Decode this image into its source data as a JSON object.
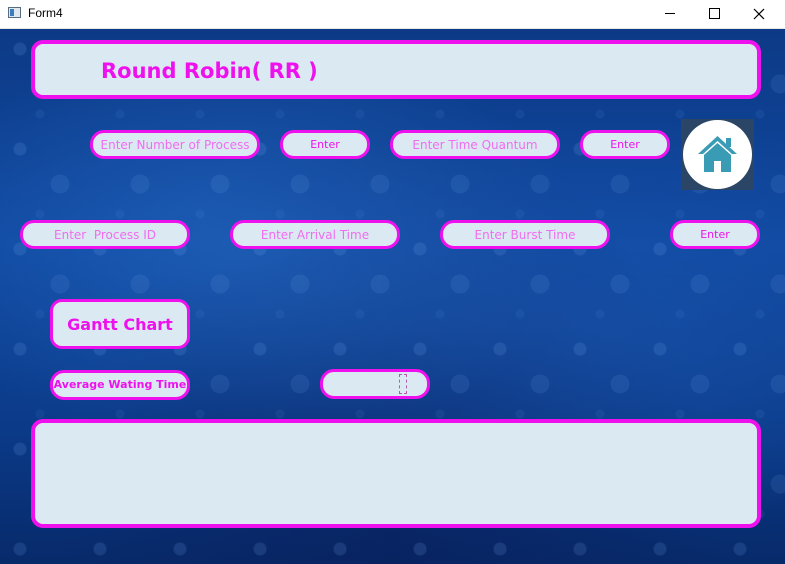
{
  "window": {
    "title": "Form4"
  },
  "header": {
    "title": "Round Robin( RR )"
  },
  "row1": {
    "process_count_placeholder": "Enter Number of Process",
    "process_count_enter": "Enter",
    "quantum_placeholder": "Enter Time Quantum",
    "quantum_enter": "Enter"
  },
  "row2": {
    "process_id_placeholder": "Enter  Process ID",
    "arrival_placeholder": "Enter Arrival Time",
    "burst_placeholder": "Enter Burst Time",
    "enter": "Enter"
  },
  "gantt": {
    "label": "Gantt Chart"
  },
  "average": {
    "label": "Average Wating Time",
    "value": ""
  },
  "icons": {
    "home": "home-icon",
    "close": "close-icon",
    "minimize": "minimize-icon",
    "maximize": "maximize-icon"
  },
  "colors": {
    "accent": "#ee11ee",
    "field_bg": "#dbeaf2",
    "background": "#0f48a0",
    "home_icon": "#3a9bb5"
  }
}
